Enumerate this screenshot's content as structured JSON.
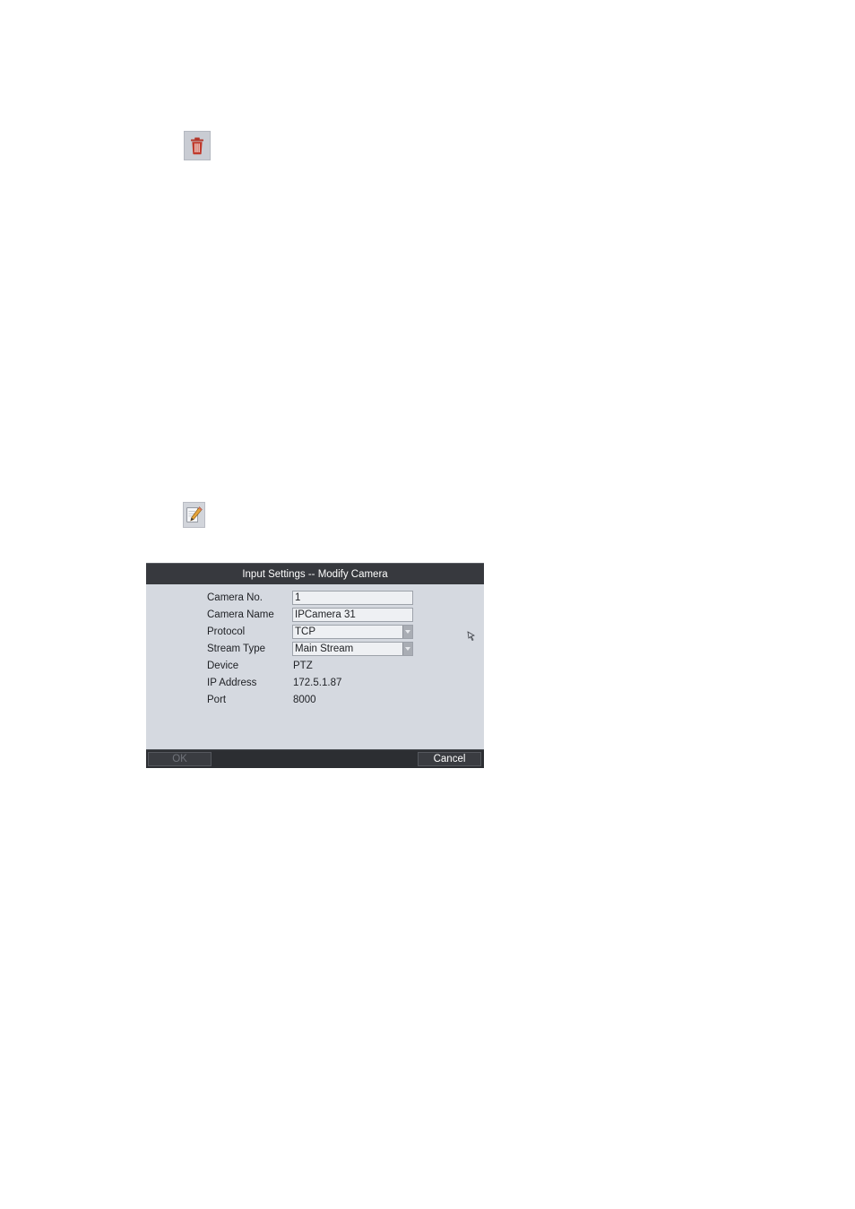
{
  "toolbar_icons": {
    "delete": "trash-icon",
    "edit": "edit-pencil-icon",
    "delete_color": "#c0392b"
  },
  "dialog": {
    "title": "Input Settings -- Modify Camera",
    "fields": {
      "camera_no": {
        "label": "Camera No.",
        "value": "1"
      },
      "camera_name": {
        "label": "Camera Name",
        "value": "IPCamera 31"
      },
      "protocol": {
        "label": "Protocol",
        "value": "TCP"
      },
      "stream_type": {
        "label": "Stream Type",
        "value": "Main Stream"
      },
      "device": {
        "label": "Device",
        "value": "PTZ"
      },
      "ip_address": {
        "label": "IP Address",
        "value": "172.5.1.87"
      },
      "port": {
        "label": "Port",
        "value": "8000"
      }
    },
    "buttons": {
      "ok": "OK",
      "cancel": "Cancel"
    }
  },
  "colors": {
    "title_bar": "#37393e",
    "body_bg": "#d5d9e0",
    "footer_bg": "#2c2e32"
  }
}
